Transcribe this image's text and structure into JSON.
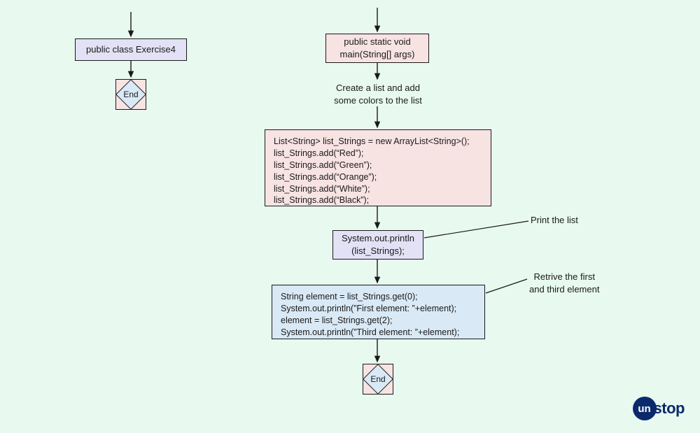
{
  "flowchart": {
    "left": {
      "class_box": "public class Exercise4",
      "end": "End"
    },
    "right": {
      "main_box": "public static void\nmain(String[] args)",
      "create_annot": "Create a list and add\nsome colors to the list",
      "list_box": "List<String> list_Strings = new ArrayList<String>();\nlist_Strings.add(“Red”);\nlist_Strings.add(“Green”);\nlist_Strings.add(“Orange”);\nlist_Strings.add(“White”);\nlist_Strings.add(“Black”);",
      "print_box": "System.out.println\n(list_Strings);",
      "print_annot": "Print the list",
      "retrieve_box": "String element = list_Strings.get(0);\nSystem.out.println(”First element: ”+element);\nelement = list_Strings.get(2);\nSystem.out.println(”Third element: ”+element);",
      "retrieve_annot": "Retrive the first\nand third element",
      "end": "End"
    }
  },
  "brand": {
    "circle": "un",
    "word": "stop"
  }
}
